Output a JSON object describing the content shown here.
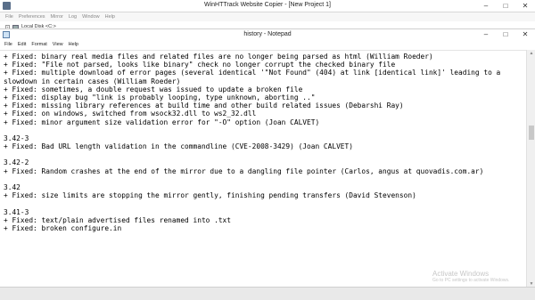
{
  "outer": {
    "title": "WinHTTrack Website Copier - [New Project 1]",
    "menu": [
      "File",
      "Preferences",
      "Mirror",
      "Log",
      "Window",
      "Help"
    ],
    "tree_label": "Local Disk <C:>"
  },
  "notepad": {
    "title": "history - Notepad",
    "menu": [
      "File",
      "Edit",
      "Format",
      "View",
      "Help"
    ],
    "lines": [
      "+ Fixed: binary real media files and related files are no longer being parsed as html (William Roeder)",
      "+ Fixed: \"File not parsed, looks like binary\" check no longer corrupt the checked binary file",
      "+ Fixed: multiple download of error pages (several identical '\"Not Found\" (404) at link [identical link]' leading to a",
      "slowdown in certain cases (William Roeder)",
      "+ Fixed: sometimes, a double request was issued to update a broken file",
      "+ Fixed: display bug \"link is probably looping, type unknown, aborting ..\"",
      "+ Fixed: missing library references at build time and other build related issues (Debarshi Ray)",
      "+ Fixed: on windows, switched from wsock32.dll to ws2_32.dll",
      "+ Fixed: minor argument size validation error for \"-O\" option (Joan CALVET)",
      "",
      "3.42-3",
      "+ Fixed: Bad URL length validation in the commandline (CVE-2008-3429) (Joan CALVET)",
      "",
      "3.42-2",
      "+ Fixed: Random crashes at the end of the mirror due to a dangling file pointer (Carlos, angus at quovadis.com.ar)",
      "",
      "3.42",
      "+ Fixed: size limits are stopping the mirror gently, finishing pending transfers (David Stevenson)",
      "",
      "3.41-3",
      "+ Fixed: text/plain advertised files renamed into .txt",
      "+ Fixed: broken configure.in"
    ]
  },
  "watermark": {
    "title": "Activate Windows",
    "subtitle": "Go to PC settings to activate Windows."
  }
}
